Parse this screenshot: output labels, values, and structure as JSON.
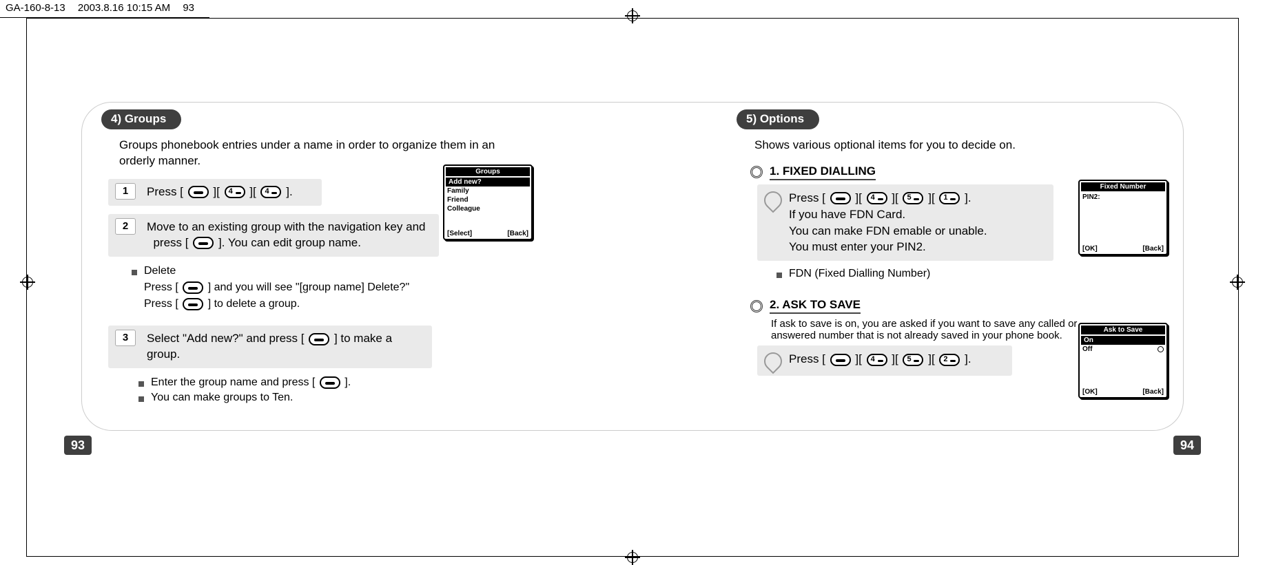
{
  "header": {
    "doc": "GA-160-8-13",
    "timestamp": "2003.8.16 10:15 AM",
    "page_marker": "93"
  },
  "page_left_num": "93",
  "page_right_num": "94",
  "left": {
    "pill": "4) Groups",
    "lead_l1": "Groups phonebook entries under a name in order to organize them in an",
    "lead_l2": "orderly manner.",
    "step1_num": "1",
    "step1_pre": "Press [",
    "step1_b1": "][",
    "step1_b2": "][",
    "step1_post": "].",
    "step2_num": "2",
    "step2_l1a": "Move to an existing group with the navigation key and",
    "step2_l2a": "press [",
    "step2_l2b": "]. You can edit group name.",
    "delete_h": "Delete",
    "delete_l1a": "Press [",
    "delete_l1b": "] and you will see \"[group name] Delete?\"",
    "delete_l2a": "Press [",
    "delete_l2b": "] to delete a group.",
    "step3_num": "3",
    "step3_a": "Select \"Add new?\" and press [",
    "step3_b": "] to make a group.",
    "b1a": "Enter the group name and press [",
    "b1b": "].",
    "b2": "You can make groups to Ten.",
    "mock": {
      "title": "Groups",
      "items": [
        "Add new?",
        "Family",
        "Friend",
        "Colleague"
      ],
      "soft_left": "[Select]",
      "soft_right": "[Back]"
    }
  },
  "right": {
    "pill": "5) Options",
    "lead": "Shows various optional items for you to decide on.",
    "h1": "1. FIXED DIALLING",
    "fd_pre": "Press [",
    "fd_b1": "][",
    "fd_b2": "][",
    "fd_b3": "][",
    "fd_post": "].",
    "fd_l2": "If you have FDN Card.",
    "fd_l3": "You can make FDN emable or unable.",
    "fd_l4": "You must enter your PIN2.",
    "fd_note": "FDN (Fixed Dialling Number)",
    "mock_fixed": {
      "title": "Fixed Number",
      "label": "PIN2:",
      "soft_left": "[OK]",
      "soft_right": "[Back]"
    },
    "h2": "2. ASK TO SAVE",
    "ats_l1": "If ask to save is on, you are asked if you want to save any called or",
    "ats_l2": "answered number that is not already saved in your phone book.",
    "ats_pre": "Press [",
    "ats_b1": "][",
    "ats_b2": "][",
    "ats_b3": "][",
    "ats_post": "].",
    "mock_ask": {
      "title": "Ask to Save",
      "on": "On",
      "off": "Off",
      "soft_left": "[OK]",
      "soft_right": "[Back]"
    }
  },
  "chart_data": null
}
